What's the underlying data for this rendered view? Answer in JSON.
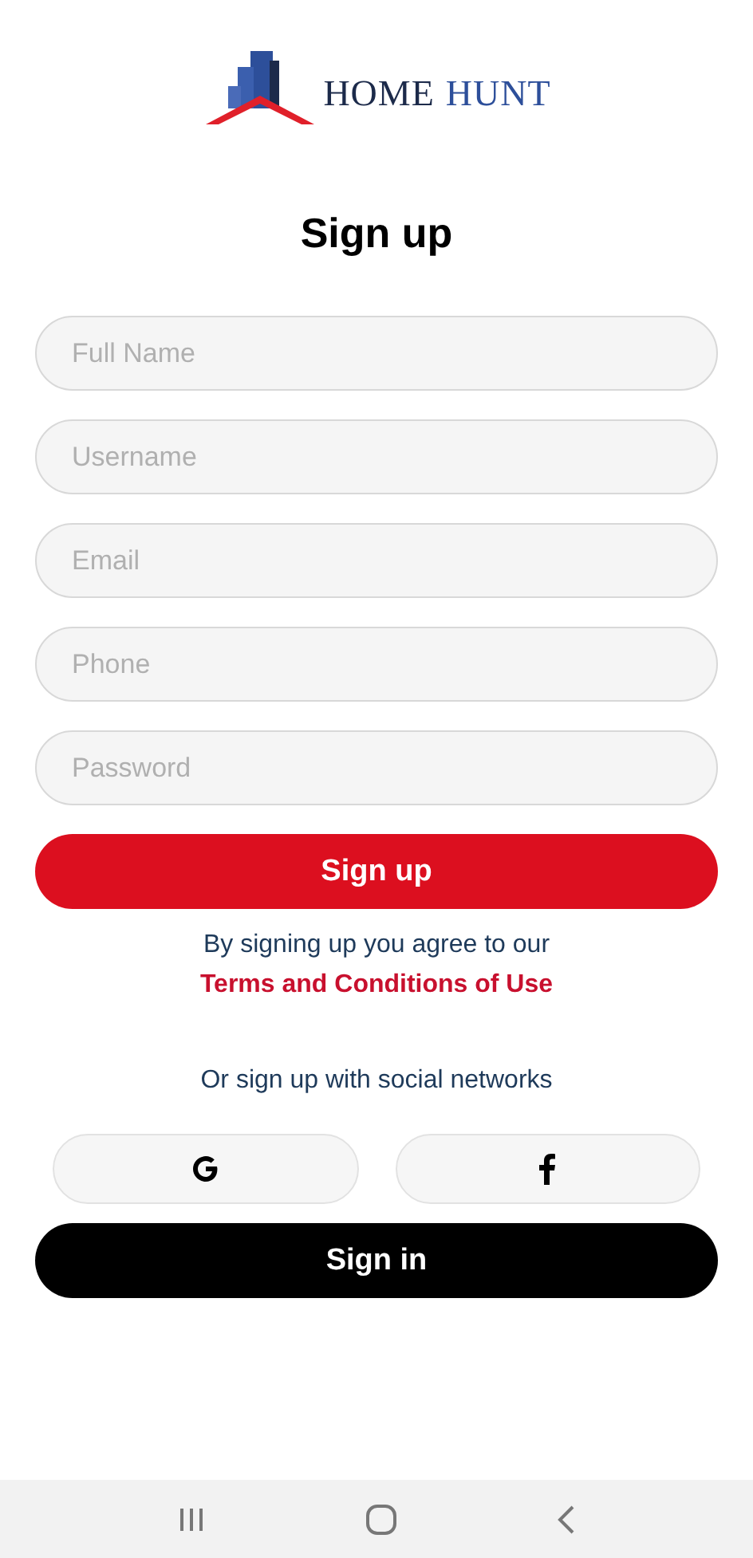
{
  "logo": {
    "word_1": "HOME",
    "word_2": "HUNT"
  },
  "title": "Sign up",
  "fields": [
    {
      "placeholder": "Full Name"
    },
    {
      "placeholder": "Username"
    },
    {
      "placeholder": "Email"
    },
    {
      "placeholder": "Phone"
    },
    {
      "placeholder": "Password"
    }
  ],
  "signup_button": "Sign up",
  "agreement": {
    "text": "By signing up you agree to our",
    "link": "Terms and Conditions of Use"
  },
  "social_prompt": "Or sign up with social networks",
  "social_buttons": [
    {
      "kind": "google"
    },
    {
      "kind": "facebook"
    }
  ],
  "signin_button": "Sign in"
}
